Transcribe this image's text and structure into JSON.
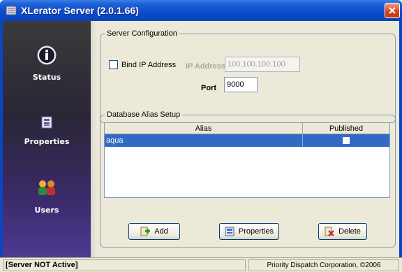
{
  "window": {
    "title": "XLerator Server (2.0.1.66)",
    "app_icon": "server-app-icon",
    "close_icon": "close-icon"
  },
  "sidebar": {
    "items": [
      {
        "label": "Status",
        "icon": "info-icon"
      },
      {
        "label": "Properties",
        "icon": "properties-icon"
      },
      {
        "label": "Users",
        "icon": "users-icon"
      }
    ]
  },
  "server_config": {
    "legend": "Server Configuration",
    "bind_ip_label": "Bind IP Address",
    "bind_ip_checked": false,
    "ip_label": "IP Address",
    "ip_value": "100.100.100.100",
    "port_label": "Port",
    "port_value": "9000"
  },
  "db_alias": {
    "legend": "Database Alias Setup",
    "columns": [
      "Alias",
      "Published"
    ],
    "rows": [
      {
        "alias": "aqua",
        "published": false
      }
    ],
    "buttons": {
      "add": "Add",
      "properties": "Properties",
      "delete": "Delete"
    }
  },
  "status_bar": {
    "left": "[Server NOT Active]",
    "right": "Priority Dispatch Corporation, ©2006"
  },
  "colors": {
    "title_bar": "#0b4bcb",
    "selection": "#316ac5",
    "panel": "#ece9d8"
  }
}
